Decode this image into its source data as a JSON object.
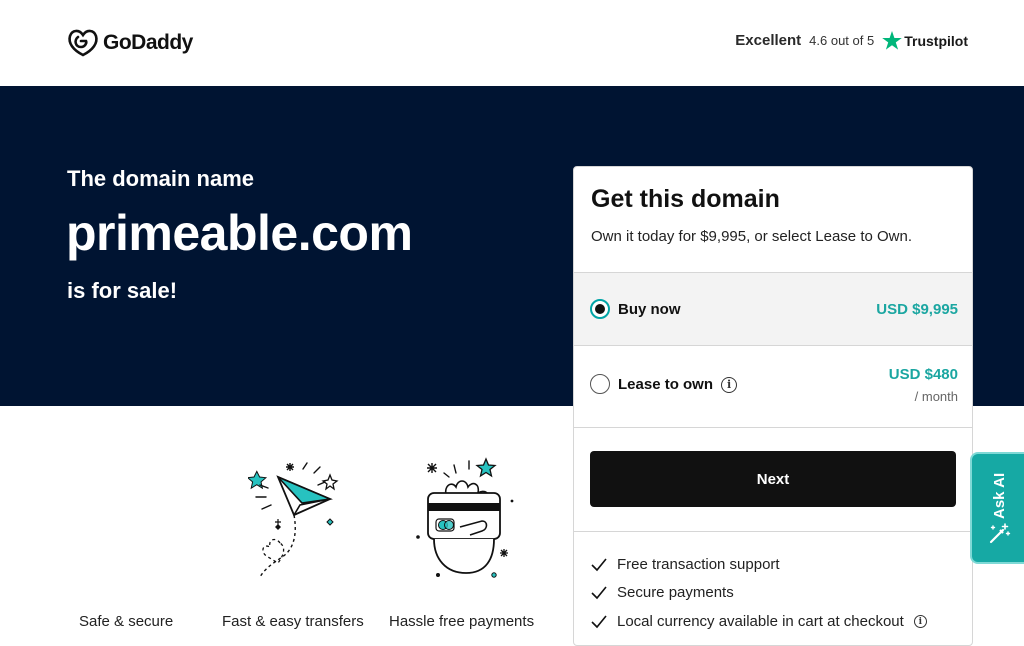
{
  "header": {
    "logo_text": "GoDaddy",
    "trustpilot": {
      "rating_word": "Excellent",
      "score_text": "4.6 out of 5",
      "brand": "Trustpilot"
    }
  },
  "hero": {
    "pre": "The domain name",
    "domain": "primeable.com",
    "post": "is for sale!"
  },
  "card": {
    "title": "Get this domain",
    "subtitle": "Own it today for $9,995, or select Lease to Own.",
    "options": [
      {
        "label": "Buy now",
        "price": "USD $9,995",
        "selected": true
      },
      {
        "label": "Lease to own",
        "price": "USD $480",
        "per": "/ month",
        "selected": false
      }
    ],
    "next_label": "Next",
    "features": [
      "Free transaction support",
      "Secure payments",
      "Local currency available in cart at checkout"
    ]
  },
  "ask_ai": {
    "label": "Ask AI"
  },
  "features_row": [
    "Safe & secure",
    "Fast & easy transfers",
    "Hassle free payments"
  ],
  "colors": {
    "hero_bg": "#001432",
    "accent": "#1ba6a1",
    "button": "#111111",
    "trustpilot_green": "#00b67a"
  }
}
